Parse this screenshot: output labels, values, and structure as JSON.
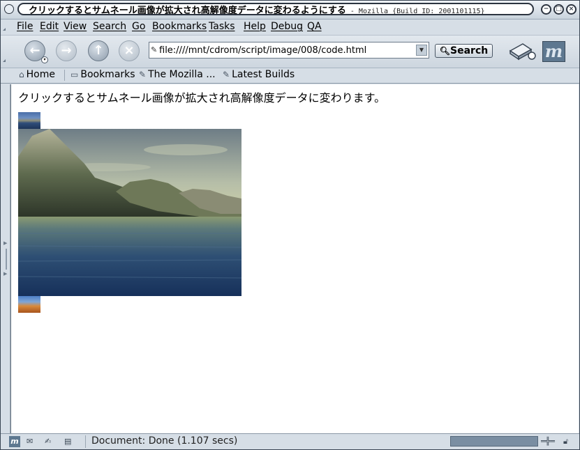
{
  "window": {
    "title": "クリックするとサムネール画像が拡大され高解像度データに変わるようにする",
    "title_suffix": " - Mozilla {Build ID: 2001101115}"
  },
  "menu": {
    "items": [
      "File",
      "Edit",
      "View",
      "Search",
      "Go",
      "Bookmarks",
      "Tasks",
      "Help",
      "Debug",
      "QA"
    ]
  },
  "nav": {
    "url": "file:////mnt/cdrom/script/image/008/code.html",
    "search_label": "Search",
    "back_icon": "back-arrow-icon",
    "forward_icon": "forward-arrow-icon",
    "reload_icon": "reload-icon",
    "stop_icon": "stop-icon"
  },
  "personal_toolbar": {
    "items": [
      {
        "label": "Home",
        "icon": "home-icon"
      },
      {
        "label": "Bookmarks",
        "icon": "folder-icon"
      },
      {
        "label": "The Mozilla ...",
        "icon": "bookmark-icon"
      },
      {
        "label": "Latest Builds",
        "icon": "bookmark-icon"
      }
    ]
  },
  "content": {
    "paragraph": "クリックするとサムネール画像が拡大され高解像度データに変わります。"
  },
  "status": {
    "text": "Document: Done (1.107 secs)"
  },
  "colors": {
    "accent": "#5e7890",
    "chrome": "#d6dee6",
    "progress": "#7a8ea2"
  }
}
